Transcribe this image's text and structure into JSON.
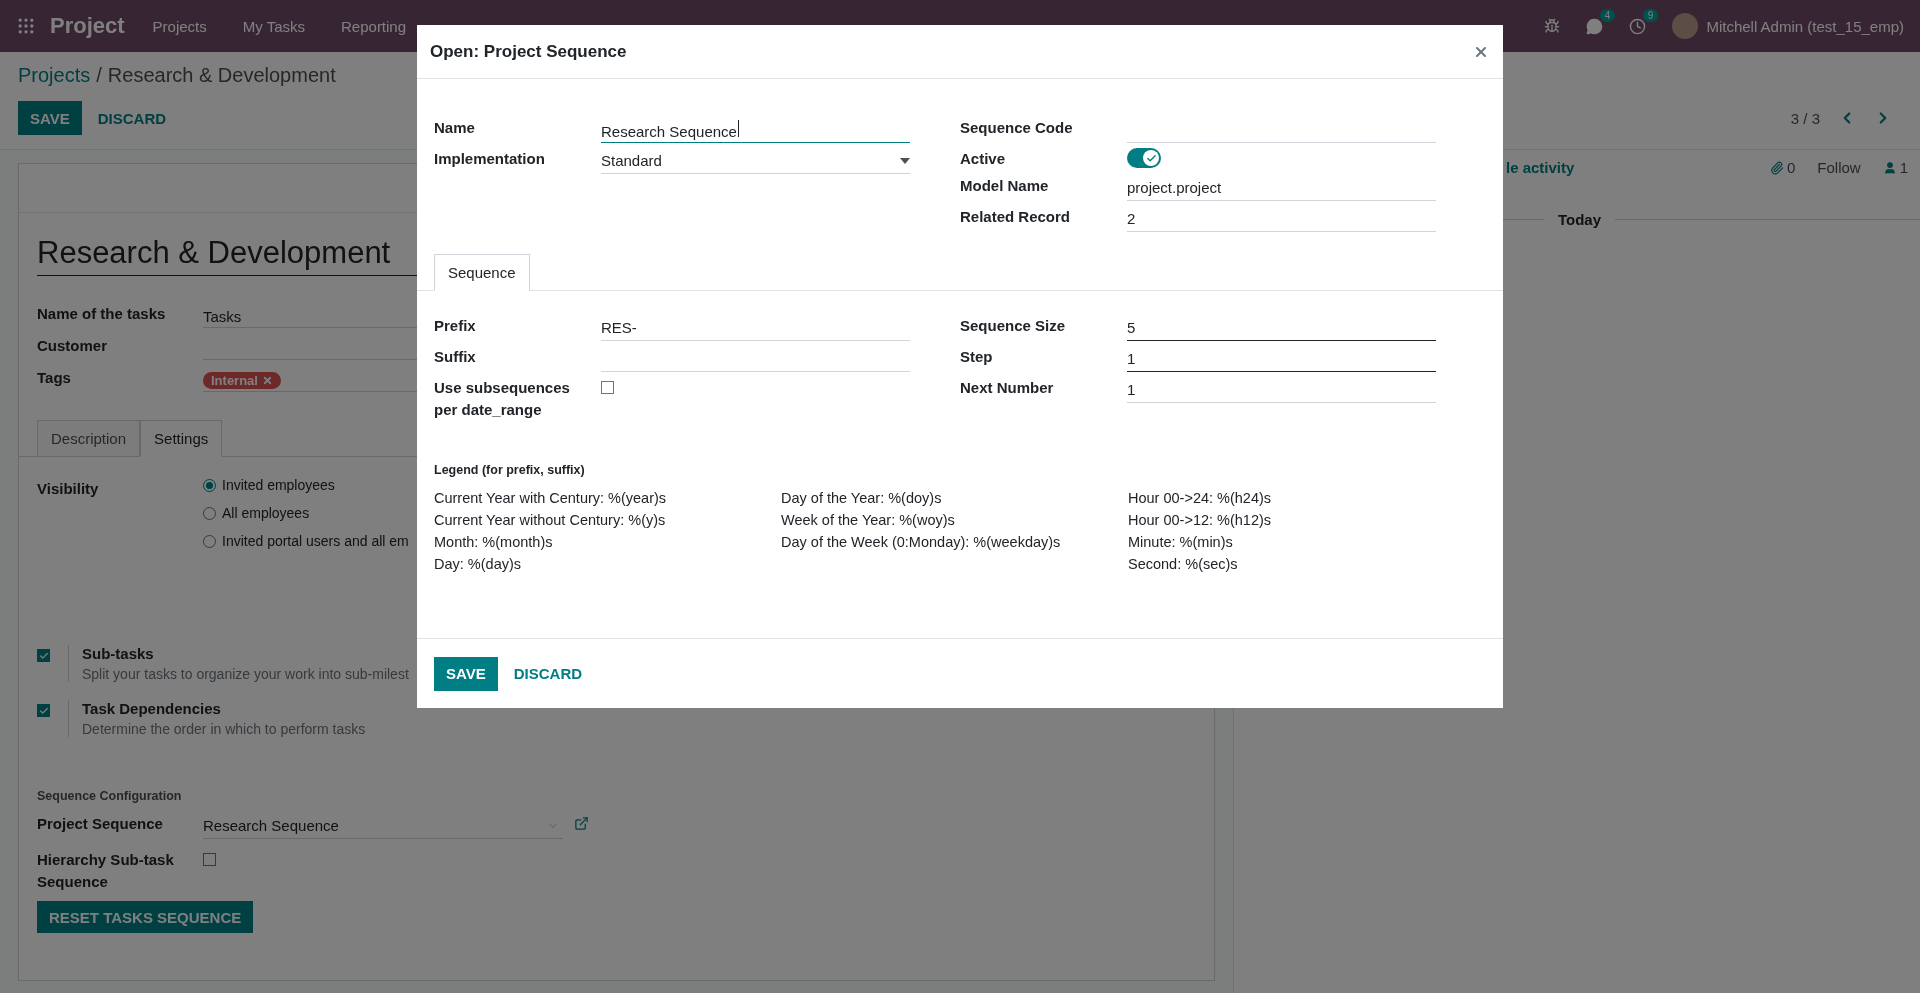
{
  "navbar": {
    "app_title": "Project",
    "menu": [
      "Projects",
      "My Tasks",
      "Reporting"
    ],
    "messages_count": "4",
    "activities_count": "9",
    "user": "Mitchell Admin (test_15_emp)"
  },
  "breadcrumb": {
    "parent": "Projects",
    "separator": "/",
    "current": "Research & Development"
  },
  "control_panel": {
    "buttons": [
      "SAVE",
      "DISCARD"
    ],
    "pager": "3 / 3"
  },
  "form": {
    "title": "Research & Development",
    "fields": [
      {
        "label": "Name of the tasks",
        "value": "Tasks"
      },
      {
        "label": "Customer"
      },
      {
        "label": "Tags",
        "tags": [
          "Internal"
        ]
      }
    ],
    "tabs": [
      {
        "label": "Description",
        "selected": false
      },
      {
        "label": "Settings",
        "selected": true
      }
    ],
    "visibility": {
      "label": "Visibility",
      "options": [
        {
          "label": "Invited employees",
          "selected": true
        },
        {
          "label": "All employees",
          "selected": false
        },
        {
          "label": "Invited portal users and all em",
          "selected": false
        }
      ]
    },
    "features": [
      {
        "title": "Sub-tasks",
        "description": "Split your tasks to organize your work into sub-milest",
        "checked": true
      },
      {
        "title": "Task Dependencies",
        "description": "Determine the order in which to perform tasks",
        "checked": true
      }
    ],
    "sequence_section": {
      "heading": "Sequence Configuration",
      "project_sequence": {
        "label": "Project Sequence",
        "value": "Research Sequence"
      },
      "hierarchy": {
        "label": "Hierarchy Sub-task Sequence",
        "checked": false
      },
      "reset_button": "RESET TASKS SEQUENCE"
    }
  },
  "chatter": {
    "schedule_activity": "le activity",
    "attachments": "0",
    "follow": "Follow",
    "followers": "1",
    "date_separator": "Today"
  },
  "dialog": {
    "title": "Open: Project Sequence",
    "left_fields": [
      {
        "label": "Name",
        "value": "Research Sequence",
        "kind": "text",
        "focused": true
      },
      {
        "label": "Implementation",
        "value": "Standard",
        "kind": "select"
      }
    ],
    "right_fields": [
      {
        "label": "Sequence Code",
        "kind": "text"
      },
      {
        "label": "Active",
        "kind": "toggle",
        "on": true
      },
      {
        "label": "Model Name",
        "value": "project.project",
        "kind": "text"
      },
      {
        "label": "Related Record",
        "value": "2",
        "kind": "text"
      }
    ],
    "tabs": [
      {
        "label": "Sequence",
        "selected": true
      }
    ],
    "sequence_left": [
      {
        "label": "Prefix",
        "value": "RES-",
        "kind": "text"
      },
      {
        "label": "Suffix",
        "kind": "text"
      },
      {
        "label": "Use subsequences per date_range",
        "kind": "checkbox",
        "checked": false
      }
    ],
    "sequence_right": [
      {
        "label": "Sequence Size",
        "value": "5",
        "kind": "text",
        "required": true
      },
      {
        "label": "Step",
        "value": "1",
        "kind": "text",
        "required": true
      },
      {
        "label": "Next Number",
        "value": "1",
        "kind": "text"
      }
    ],
    "legend": {
      "title": "Legend (for prefix, suffix)",
      "columns": [
        [
          "Current Year with Century: %(year)s",
          "Current Year without Century: %(y)s",
          "Month: %(month)s",
          "Day: %(day)s"
        ],
        [
          "Day of the Year: %(doy)s",
          "Week of the Year: %(woy)s",
          "Day of the Week (0:Monday): %(weekday)s"
        ],
        [
          "Hour 00->24: %(h24)s",
          "Hour 00->12: %(h12)s",
          "Minute: %(min)s",
          "Second: %(sec)s"
        ]
      ]
    },
    "buttons": [
      "SAVE",
      "DISCARD"
    ]
  }
}
